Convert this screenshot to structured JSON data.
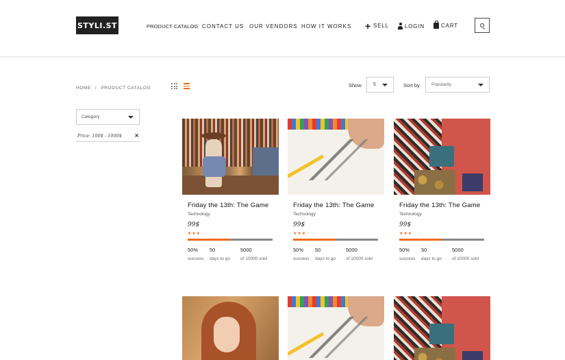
{
  "header": {
    "logo": "STYLI.ST",
    "nav": [
      "PRODUCT CATALOG",
      "CONTACT US",
      "OUR VENDORS",
      "HOW IT WORKS"
    ],
    "actions": {
      "sell": "SELL",
      "login": "LOGIN",
      "cart": "CART"
    }
  },
  "breadcrumb": {
    "home": "HOME",
    "sep": "/",
    "current": "PRODUCT CATALOG"
  },
  "toolbar": {
    "show_label": "Show",
    "show_value": "5",
    "sort_label": "Sort by",
    "sort_value": "Popularity"
  },
  "filters": {
    "category": "Category",
    "price": "Price: 100$ - 1000$",
    "remove": "×"
  },
  "products": [
    {
      "title": "Friday the 13th: The Game",
      "category": "Technology",
      "price": "99$",
      "rating": 3,
      "progress": 0.5,
      "stats": {
        "pct": "50%",
        "pct_label": "success",
        "days": "50",
        "days_label": "days to go",
        "sold": "5000",
        "sold_label": "of 10000 sold"
      }
    },
    {
      "title": "Friday the 13th: The Game",
      "category": "Technology",
      "price": "99$",
      "rating": 3,
      "progress": 0.5,
      "stats": {
        "pct": "50%",
        "pct_label": "success",
        "days": "50",
        "days_label": "days to go",
        "sold": "5000",
        "sold_label": "of 10000 sold"
      }
    },
    {
      "title": "Friday the 13th: The Game",
      "category": "Technology",
      "price": "99$",
      "rating": 3,
      "progress": 0.5,
      "stats": {
        "pct": "50%",
        "pct_label": "success",
        "days": "50",
        "days_label": "days to go",
        "sold": "5000",
        "sold_label": "of 10000 sold"
      }
    }
  ],
  "colors": {
    "accent": "#f26a1b",
    "bar_track": "#888888",
    "text": "#222222"
  },
  "icons": [
    "plus-icon",
    "person-icon",
    "bag-icon",
    "search-icon",
    "grid-view-icon",
    "list-view-icon",
    "chevron-down-icon",
    "close-icon",
    "star-icon"
  ]
}
